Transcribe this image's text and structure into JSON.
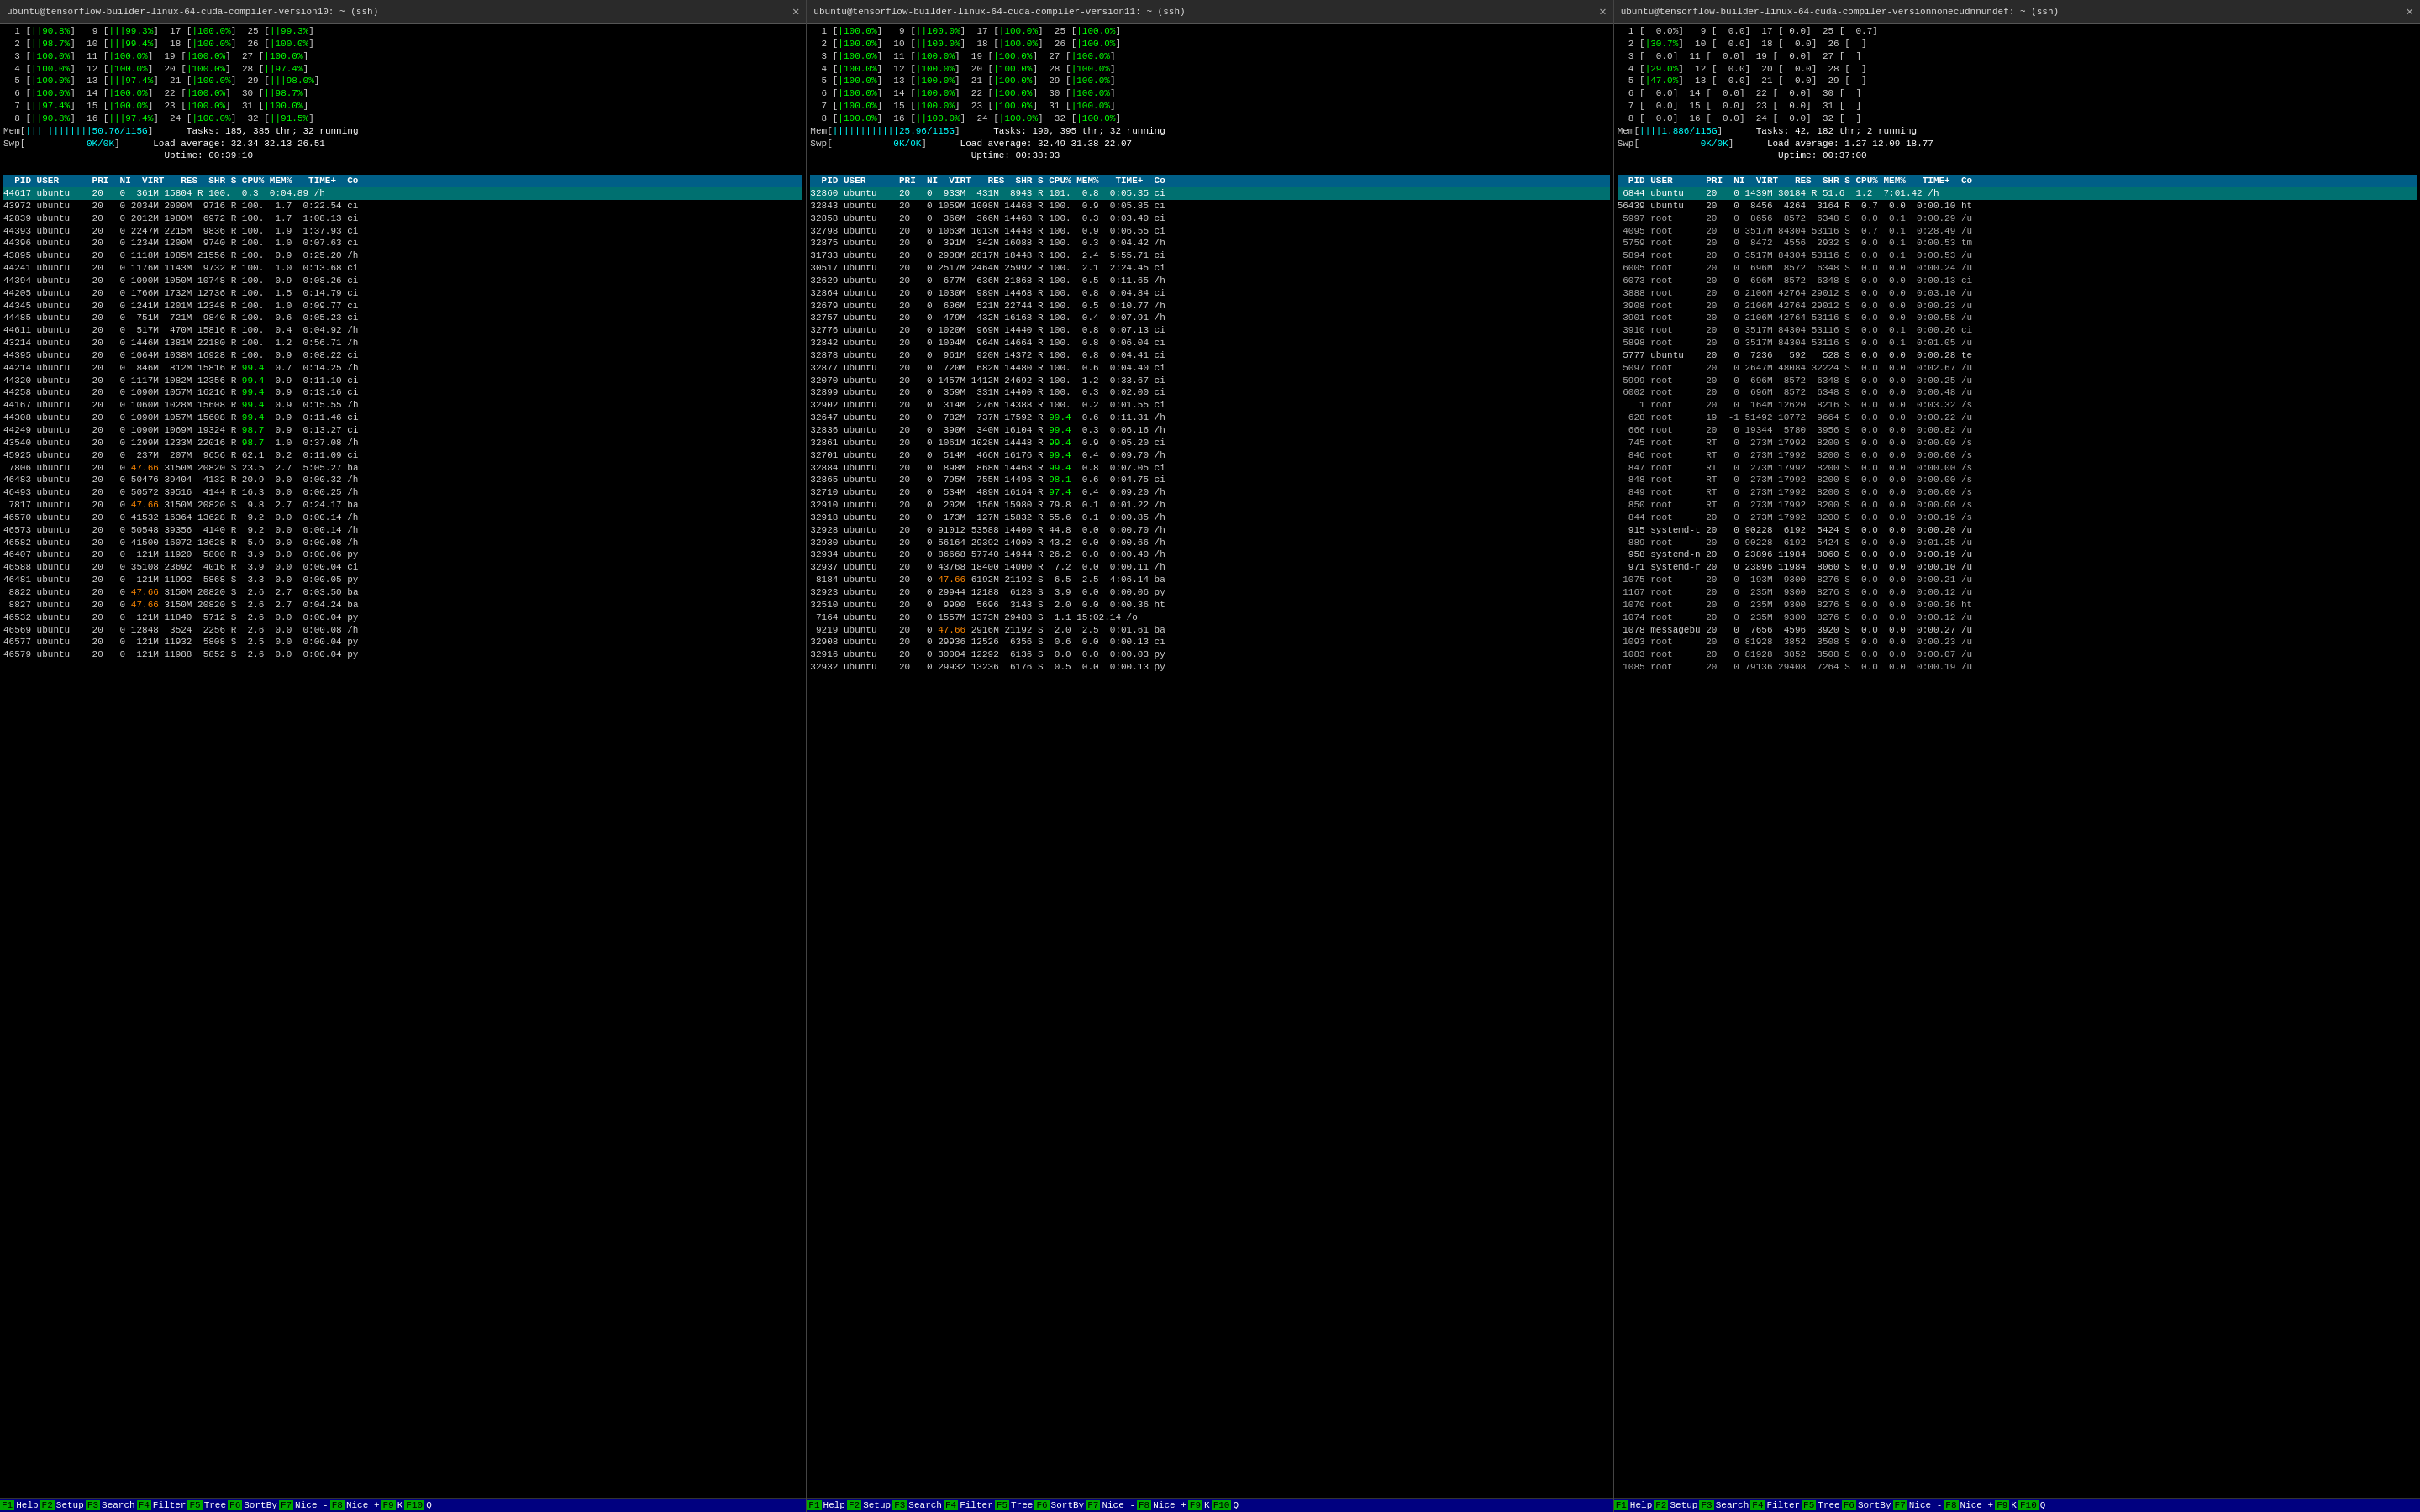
{
  "terminals": [
    {
      "id": "t1",
      "title": "ubuntu@tensorflow-builder-linux-64-cuda-compiler-version10: ~ (ssh)",
      "htop": {
        "cpu_lines": [
          "  1 [||90.8%]   9 [|||99.3%]  17 [|100.0%]  25 [||99.3%]",
          "  2 [||98.7%]  10 [|||99.4%]  18 [|100.0%]  26 [|100.0%]",
          "  3 [|100.0%]  11 [|100.0%]  19 [|100.0%]  27 [|100.0%]",
          "  4 [|100.0%]  12 [|100.0%]  20 [|100.0%]  28 [||97.4%]",
          "  5 [|100.0%]  13 [|||97.4%]  21 [|100.0%]  29 [|||98.0%]",
          "  6 [|100.0%]  14 [|100.0%]  22 [|100.0%]  30 [||98.7%]",
          "  7 [||97.4%]  15 [|100.0%]  23 [|100.0%]  31 [|100.0%]",
          "  8 [||90.8%]  16 [|||97.4%]  24 [|100.0%]  32 [||91.5%]"
        ],
        "mem_line": "Mem[||||||||||||50.76/115G]",
        "swap_line": "Swp[           0K/0K]",
        "tasks": "Tasks: 185, 385 thr; 32 running",
        "load": "Load average: 32.34 32.13 26.51",
        "uptime": "Uptime: 00:39:10",
        "col_header": "  PID USER      PRI  NI  VIRT   RES  SHR S CPU% MEM%   TIME+  Co",
        "selected_pid": "44617",
        "selected_user": "ubuntu",
        "selected_line": "44617 ubuntu    20   0  361M 15804 R 100.  0.3  0:04.89 /h",
        "processes": [
          "43972 ubuntu    20   0 2034M 2000M  9716 R 100.  1.7  0:22.54 ci",
          "42839 ubuntu    20   0 2012M 1980M  6972 R 100.  1.7  1:08.13 ci",
          "44393 ubuntu    20   0 2247M 2215M  9836 R 100.  1.9  1:37.93 ci",
          "44396 ubuntu    20   0 1234M 1200M  9740 R 100.  1.0  0:07.63 ci",
          "43895 ubuntu    20   0 1118M 1085M 21556 R 100.  0.9  0:25.20 /h",
          "44241 ubuntu    20   0 1176M 1143M  9732 R 100.  1.0  0:13.68 ci",
          "44394 ubuntu    20   0 1090M 1050M 10748 R 100.  0.9  0:08.26 ci",
          "44205 ubuntu    20   0 1766M 1732M 12736 R 100.  1.5  0:14.79 ci",
          "44345 ubuntu    20   0 1241M 1201M 12348 R 100.  1.0  0:09.77 ci",
          "44485 ubuntu    20   0  751M  721M  9840 R 100.  0.6  0:05.23 ci",
          "44611 ubuntu    20   0  517M  470M 15816 R 100.  0.4  0:04.92 /h",
          "43214 ubuntu    20   0 1446M 1381M 22180 R 100.  1.2  0:56.71 /h",
          "44395 ubuntu    20   0 1064M 1038M 16928 R 100.  0.9  0:08.22 ci",
          "44214 ubuntu    20   0  846M  812M 15816 R 99.4  0.7  0:14.25 /h",
          "44320 ubuntu    20   0 1117M 1082M 12356 R 99.4  0.9  0:11.10 ci",
          "44258 ubuntu    20   0 1090M 1057M 16216 R 99.4  0.9  0:13.16 ci",
          "44167 ubuntu    20   0 1060M 1028M 15608 R 99.4  0.9  0:15.55 /h",
          "44308 ubuntu    20   0 1090M 1057M 15608 R 99.4  0.9  0:11.46 ci",
          "44249 ubuntu    20   0 1090M 1069M 19324 R 98.7  0.9  0:13.27 ci",
          "43540 ubuntu    20   0 1299M 1233M 22016 R 98.7  1.0  0:37.08 /h",
          "45925 ubuntu    20   0  237M  207M  9656 R 62.1  0.2  0:11.09 ci",
          " 7806 ubuntu    20   0 47.66 3150M 20820 S 23.5  2.7  5:05.27 ba",
          "46483 ubuntu    20   0 50476 39404  4132 R 20.9  0.0  0:00.32 /h",
          "46493 ubuntu    20   0 50572 39516  4144 R 16.3  0.0  0:00.25 /h",
          " 7817 ubuntu    20   0 47.66 3150M 20820 S  9.8  2.7  0:24.17 ba",
          "46570 ubuntu    20   0 41532 16364 13628 R  9.2  0.0  0:00.14 /h",
          "46573 ubuntu    20   0 50548 39356  4140 R  9.2  0.0  0:00.14 /h",
          "46582 ubuntu    20   0 41500 16072 13628 R  5.9  0.0  0:00.08 /h",
          "46407 ubuntu    20   0  121M 11920  5800 R  3.9  0.0  0:00.06 py",
          "46588 ubuntu    20   0 35108 23692  4016 R  3.9  0.0  0:00.04 ci",
          "46481 ubuntu    20   0  121M 11992  5868 S  3.3  0.0  0:00.05 py",
          " 8822 ubuntu    20   0 47.66 3150M 20820 S  2.6  2.7  0:03.50 ba",
          " 8827 ubuntu    20   0 47.66 3150M 20820 S  2.6  2.7  0:04.24 ba",
          "46532 ubuntu    20   0  121M 11840  5712 S  2.6  0.0  0:00.04 py",
          "46569 ubuntu    20   0 12848  3524  2256 R  2.6  0.0  0:00.08 /h",
          "46577 ubuntu    20   0  121M 11932  5808 S  2.5  0.0  0:00.04 py",
          "46579 ubuntu    20   0  121M 11988  5852 S  2.6  0.0  0:00.04 py"
        ]
      },
      "footer": [
        "F1Help",
        "F2Setup",
        "F3SearchF4Filter",
        "F5Tree",
        "F6SortByF7Nice -F8Nice +F9K"
      ]
    },
    {
      "id": "t2",
      "title": "ubuntu@tensorflow-builder-linux-64-cuda-compiler-version11: ~ (ssh)",
      "htop": {
        "cpu_lines": [
          "  1 [|100.0%]   9 [||100.0%]  17 [|100.0%]  25 [|100.0%]",
          "  2 [|100.0%]  10 [||100.0%]  18 [|100.0%]  26 [|100.0%]",
          "  3 [|100.0%]  11 [|100.0%]  19 [|100.0%]  27 [|100.0%]",
          "  4 [|100.0%]  12 [|100.0%]  20 [|100.0%]  28 [|100.0%]",
          "  5 [|100.0%]  13 [|100.0%]  21 [|100.0%]  29 [|100.0%]",
          "  6 [|100.0%]  14 [|100.0%]  22 [|100.0%]  30 [|100.0%]",
          "  7 [|100.0%]  15 [|100.0%]  23 [|100.0%]  31 [|100.0%]",
          "  8 [|100.0%]  16 [||100.0%]  24 [|100.0%]  32 [|100.0%]"
        ],
        "mem_line": "Mem[||||||||||||25.96/115G]",
        "swap_line": "Swp[           0K/0K]",
        "tasks": "Tasks: 190, 395 thr; 32 running",
        "load": "Load average: 32.49 31.38 22.07",
        "uptime": "Uptime: 00:38:03",
        "col_header": "  PID USER      PRI  NI  VIRT   RES  SHR S CPU% MEM%   TIME+  Co",
        "selected_pid": "32860",
        "selected_user": "ubuntu",
        "selected_line": "32860 ubuntu    20   0  933M  431M  8943 R 101.  0.8  0:05.35 ci",
        "processes": [
          "32843 ubuntu    20   0 1059M 1008M 14468 R 100.  0.9  0:05.85 ci",
          "32858 ubuntu    20   0  366M  366M 14468 R 100.  0.3  0:03.40 ci",
          "32798 ubuntu    20   0 1063M 1013M 14448 R 100.  0.9  0:06.55 ci",
          "32875 ubuntu    20   0  391M  342M 16088 R 100.  0.3  0:04.42 /h",
          "31733 ubuntu    20   0 2908M 2817M 18448 R 100.  2.4  5:55.71 ci",
          "30517 ubuntu    20   0 2517M 2464M 25992 R 100.  2.1  2:24.45 ci",
          "32629 ubuntu    20   0  677M  636M 21868 R 100.  0.5  0:11.65 /h",
          "32864 ubuntu    20   0 1030M  989M 14468 R 100.  0.8  0:04.84 ci",
          "32679 ubuntu    20   0  606M  521M 22744 R 100.  0.5  0:10.77 /h",
          "32757 ubuntu    20   0  479M  432M 16168 R 100.  0.4  0:07.91 /h",
          "32776 ubuntu    20   0 1020M  969M 14440 R 100.  0.8  0:07.13 ci",
          "32842 ubuntu    20   0 1004M  964M 14664 R 100.  0.8  0:06.04 ci",
          "32878 ubuntu    20   0  961M  920M 14372 R 100.  0.8  0:04.41 ci",
          "32877 ubuntu    20   0  720M  682M 14480 R 100.  0.6  0:04.40 ci",
          "32070 ubuntu    20   0 1457M 1412M 24692 R 100.  1.2  0:33.67 ci",
          "32899 ubuntu    20   0  359M  331M 14400 R 100.  0.3  0:02.00 ci",
          "32902 ubuntu    20   0  314M  276M 14388 R 100.  0.2  0:01.55 ci",
          "32647 ubuntu    20   0  782M  737M 17592 R 99.4  0.6  0:11.31 /h",
          "32836 ubuntu    20   0  390M  340M 16104 R 99.4  0.3  0:06.16 /h",
          "32861 ubuntu    20   0 1061M 1028M 14448 R 99.4  0.9  0:05.20 ci",
          "32701 ubuntu    20   0  514M  466M 16176 R 99.4  0.4  0:09.70 /h",
          "32884 ubuntu    20   0  898M  868M 14468 R 99.4  0.8  0:07.05 ci",
          "32865 ubuntu    20   0  795M  755M 14496 R 98.1  0.6  0:04.75 ci",
          "32710 ubuntu    20   0  534M  489M 16164 R 97.4  0.4  0:09.20 /h",
          "32910 ubuntu    20   0  202M  156M 15980 R 79.8  0.1  0:01.22 /h",
          "32918 ubuntu    20   0  173M  127M 15832 R 55.6  0.1  0:00.85 /h",
          "32928 ubuntu    20   0 91012 53588 14400 R 44.8  0.0  0:00.70 /h",
          "32930 ubuntu    20   0 56164 29392 14000 R 43.2  0.0  0:00.66 /h",
          "32934 ubuntu    20   0 86668 57740 14944 R 26.2  0.0  0:00.40 /h",
          "32937 ubuntu    20   0 43768 18400 14000 R  7.2  0.0  0:00.11 /h",
          " 8184 ubuntu    20   0 47.66 6192M 21192 S  6.5  2.5  4:06.14 ba",
          "32923 ubuntu    20   0 29944 12188  6128 S  3.9  0.0  0:00.06 py",
          "32510 ubuntu    20   0  9900  5696  3148 S  2.0  0.0  0:00.36 ht",
          " 7164 ubuntu    20   0 1557M 1373M 29488 S  1.1 15:02.14 /o",
          " 9219 ubuntu    20   0 47.66 2916M 21192 S  2.0  2.5  0:01.61 ba",
          "32908 ubuntu    20   0 29936 12526  6356 S  0.6  0.0  0:00.13 ci",
          "32916 ubuntu    20   0 30004 12292  6136 S  0.0  0.0  0:00.03 py",
          "32932 ubuntu    20   0 29932 13236  6176 S  0.5  0.0  0:00.13 py"
        ]
      },
      "footer": [
        "F1Help",
        "F2Setup",
        "F3SearchF4Filter",
        "F5Tree",
        "F6SortByF7Nice -F8Nice +F9K"
      ]
    },
    {
      "id": "t3",
      "title": "ubuntu@tensorflow-builder-linux-64-cuda-compiler-versionnonecudnnundef: ~ (ssh)",
      "htop": {
        "cpu_lines": [
          "  1 [  0.0%]   9 [  0.0]  17 [ 0.0]  25 [  0.7]",
          "  2 [|30.7%]  10 [  0.0]  18 [  0.0]  26 [  ]",
          "  3 [  0.0]  11 [  0.0]  19 [  0.0]  27 [  ]",
          "  4 [|29.0%]  12 [  0.0]  20 [  0.0]  28 [  ]",
          "  5 [|47.0%]  13 [  0.0]  21 [  0.0]  29 [  ]",
          "  6 [  0.0]  14 [  0.0]  22 [  0.0]  30 [  ]",
          "  7 [  0.0]  15 [  0.0]  23 [  0.0]  31 [  ]",
          "  8 [  0.0]  16 [  0.0]  24 [  0.0]  32 [  ]"
        ],
        "mem_line": "Mem[||||1.886/115G]",
        "swap_line": "Swp[           0K/0K]",
        "tasks": "Tasks: 42, 182 thr; 2 running",
        "load": "Load average: 1.27 12.09 18.77",
        "uptime": "Uptime: 00:37:00",
        "col_header": "  PID USER      PRI  NI  VIRT   RES  SHR S CPU% MEM%   TIME+  Co",
        "selected_pid": "6844",
        "selected_user": "ubuntu",
        "selected_line": " 6844 ubuntu    20   0 1439M 30184 R 51.6  1.2  7:01.42 /h",
        "processes": [
          "56439 ubuntu    20   0  8456  4264  3164 R  0.7  0.0  0:00.10 ht",
          " 5997 root      20   0  8656  8572  6348 S  0.0  0.1  0:00.29 /u",
          " 4095 root      20   0 3517M 84304 53116 S  0.7  0.1  0:28.49 /u",
          " 5759 root      20   0  8472  4556  2932 S  0.0  0.1  0:00.53 tm",
          " 5894 root      20   0 3517M 84304 53116 S  0.0  0.1  0:00.53 /u",
          " 6005 root      20   0  696M  8572  6348 S  0.0  0.0  0:00.24 /u",
          " 6073 root      20   0  696M  8572  6348 S  0.0  0.0  0:00.13 ci",
          " 3888 root      20   0 2106M 42764 29012 S  0.0  0.0  0:03.10 /u",
          " 3908 root      20   0 2106M 42764 29012 S  0.0  0.0  0:00.23 /u",
          " 3901 root      20   0 2106M 42764 53116 S  0.0  0.0  0:00.58 /u",
          " 3910 root      20   0 3517M 84304 53116 S  0.0  0.1  0:00.26 ci",
          " 5898 root      20   0 3517M 84304 53116 S  0.0  0.1  0:01.05 /u",
          " 5777 ubuntu    20   0  7236   592   528 S  0.0  0.0  0:00.28 te",
          " 5097 root      20   0 2647M 48084 32224 S  0.0  0.0  0:02.67 /u",
          " 5999 root      20   0  696M  8572  6348 S  0.0  0.0  0:00.25 /u",
          " 6002 root      20   0  696M  8572  6348 S  0.0  0.0  0:00.48 /u",
          "    1 root      20   0  164M 12620  8216 S  0.0  0.0  0:03.32 /s",
          "  628 root      19  -1 51492 10772  9664 S  0.0  0.0  0:00.22 /u",
          "  666 root      20   0 19344  5780  3956 S  0.0  0.0  0:00.82 /u",
          "  745 root      RT   0  273M 17992  8200 S  0.0  0.0  0:00.00 /s",
          "  846 root      RT   0  273M 17992  8200 S  0.0  0.0  0:00.00 /s",
          "  847 root      RT   0  273M 17992  8200 S  0.0  0.0  0:00.00 /s",
          "  848 root      RT   0  273M 17992  8200 S  0.0  0.0  0:00.00 /s",
          "  849 root      RT   0  273M 17992  8200 S  0.0  0.0  0:00.00 /s",
          "  850 root      RT   0  273M 17992  8200 S  0.0  0.0  0:00.00 /s",
          "  844 root      20   0  273M 17992  8200 S  0.0  0.0  0:00.19 /s",
          "  915 systemd-t 20   0 90228  6192  5424 S  0.0  0.0  0:00.20 /u",
          "  889 root      20   0 90228  6192  5424 S  0.0  0.0  0:01.25 /u",
          "  958 systemd-n 20   0 23896 11984  8060 S  0.0  0.0  0:00.19 /u",
          "  971 systemd-r 20   0 23896 11984  8060 S  0.0  0.0  0:00.10 /u",
          " 1075 root      20   0  193M  9300  8276 S  0.0  0.0  0:00.21 /u",
          " 1167 root      20   0  235M  9300  8276 S  0.0  0.0  0:00.12 /u",
          " 1070 root      20   0  235M  9300  8276 S  0.0  0.0  0:00.36 ht",
          " 1074 root      20   0  235M  9300  8276 S  0.0  0.0  0:00.12 /u",
          " 1078 messagebu 20   0  7656  4596  3920 S  0.0  0.0  0:00.27 /u",
          " 1093 root      20   0 81928  3852  3508 S  0.0  0.0  0:00.23 /u",
          " 1083 root      20   0 81928  3852  3508 S  0.0  0.0  0:00.07 /u",
          " 1085 root      20   0 79136 29408  7264 S  0.0  0.0  0:00.19 /u"
        ]
      },
      "footer": [
        "F1Help",
        "F2Setup",
        "F3SearchF4Filter",
        "F5Tree",
        "F6SortByF7Nice -F8Nice +F9K"
      ]
    }
  ]
}
